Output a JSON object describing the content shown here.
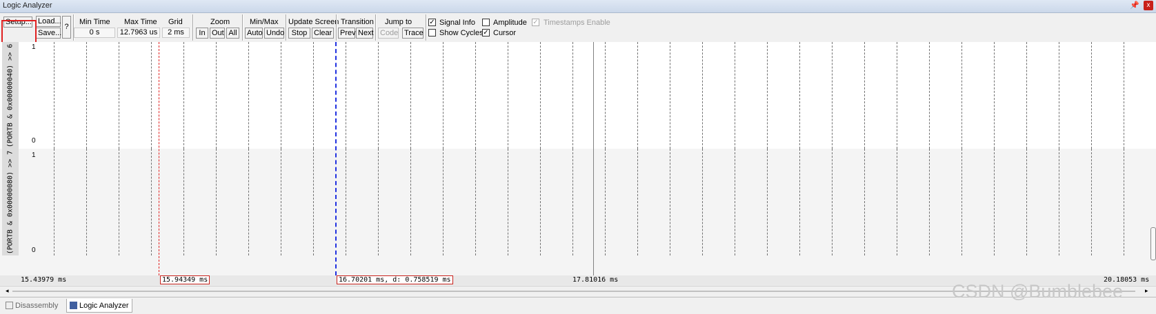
{
  "window": {
    "title": "Logic Analyzer",
    "pin_glyph": "📌",
    "close_glyph": "x"
  },
  "toolbar": {
    "setup": "Setup...",
    "load": "Load...",
    "save": "Save...",
    "help": "?",
    "min_time": {
      "label": "Min Time",
      "value": "0 s"
    },
    "max_time": {
      "label": "Max Time",
      "value": "12.7963 us"
    },
    "grid": {
      "label": "Grid",
      "value": "2 ms"
    },
    "zoom": {
      "label": "Zoom",
      "in": "In",
      "out": "Out",
      "all": "All"
    },
    "minmax": {
      "label": "Min/Max",
      "auto": "Auto",
      "undo": "Undo"
    },
    "update": {
      "label": "Update Screen",
      "stop": "Stop",
      "clear": "Clear"
    },
    "transition": {
      "label": "Transition",
      "prev": "Prev",
      "next": "Next"
    },
    "jump": {
      "label": "Jump to",
      "code": "Code",
      "trace": "Trace"
    },
    "signal_info": {
      "label": "Signal Info",
      "checked": true
    },
    "show_cycles": {
      "label": "Show Cycles",
      "checked": false
    },
    "amplitude": {
      "label": "Amplitude",
      "checked": false
    },
    "cursor": {
      "label": "Cursor",
      "checked": true
    },
    "timestamps": {
      "label": "Timestamps Enable",
      "checked": true,
      "disabled": true
    }
  },
  "signals": [
    {
      "name": "(PORTB & 0x00000040) >> 6",
      "high": "1",
      "low": "0"
    },
    {
      "name": "(PORTB & 0x00000080) >> 7",
      "high": "1",
      "low": "0"
    }
  ],
  "timeline": {
    "start": "15.43979 ms",
    "red_cursor": "15.94349 ms",
    "blue_cursor": "16.70201 ms,  d: 0.758519 ms",
    "mid": "17.81016 ms",
    "end": "20.18053 ms"
  },
  "colors": {
    "red_cursor": "#e02020",
    "blue_cursor": "#2030e0",
    "grid": "#707070",
    "highlight": "#e02020"
  },
  "tabs": [
    {
      "label": "Disassembly",
      "icon": "disassembly-icon",
      "active": false
    },
    {
      "label": "Logic Analyzer",
      "icon": "logic-analyzer-icon",
      "active": true
    }
  ],
  "watermark": "CSDN @Bumblebee"
}
